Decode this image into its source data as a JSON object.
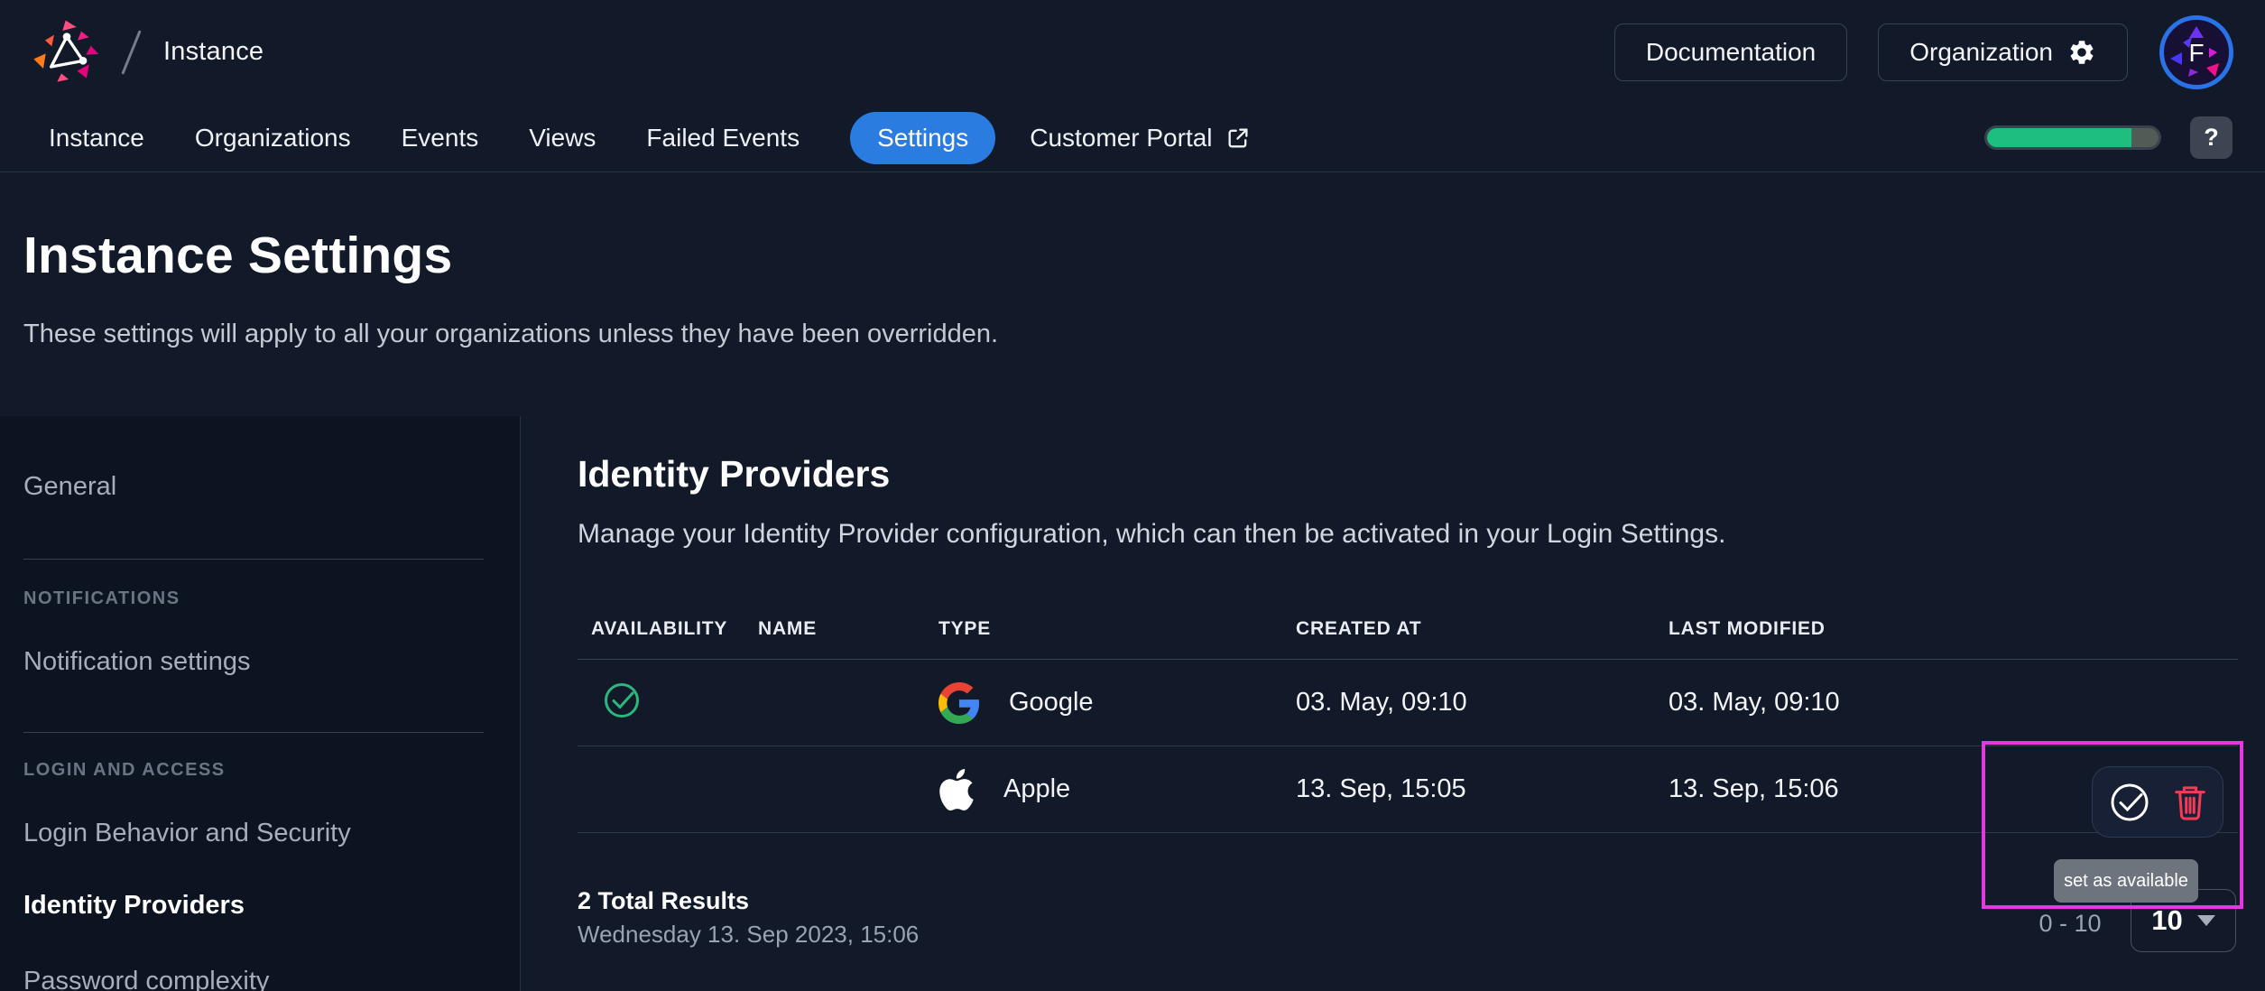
{
  "header": {
    "breadcrumb": "Instance",
    "documentation_button": "Documentation",
    "organization_button": "Organization",
    "avatar_letter": "F"
  },
  "nav": {
    "items": [
      "Instance",
      "Organizations",
      "Events",
      "Views",
      "Failed Events",
      "Settings",
      "Customer Portal"
    ],
    "active_item": "Settings",
    "progress_percent": 84,
    "help_button": "?"
  },
  "hero": {
    "title": "Instance Settings",
    "subtitle": "These settings will apply to all your organizations unless they have been overridden."
  },
  "sidebar": {
    "general_item": "General",
    "section_notifications": "NOTIFICATIONS",
    "notification_settings_item": "Notification settings",
    "section_login_access": "LOGIN AND ACCESS",
    "login_behavior_item": "Login Behavior and Security",
    "identity_providers_item": "Identity Providers",
    "password_complexity_item": "Password complexity",
    "active_item": "Identity Providers"
  },
  "content": {
    "title": "Identity Providers",
    "description": "Manage your Identity Provider configuration, which can then be activated in your Login Settings.",
    "table": {
      "columns": [
        "AVAILABILITY",
        "NAME",
        "TYPE",
        "CREATED AT",
        "LAST MODIFIED"
      ],
      "rows": [
        {
          "available": true,
          "name": "",
          "type": "Google",
          "created_at": "03. May, 09:10",
          "last_modified": "03. May, 09:10"
        },
        {
          "available": false,
          "name": "",
          "type": "Apple",
          "created_at": "13. Sep, 15:05",
          "last_modified": "13. Sep, 15:06"
        }
      ]
    },
    "total_results": "2 Total Results",
    "timestamp": "Wednesday 13. Sep 2023, 15:06",
    "pagination": {
      "range": "0 - 10",
      "page_size": "10"
    }
  },
  "overlay": {
    "tooltip": "set as available"
  },
  "colors": {
    "accent_blue": "#2b7ce0",
    "success_green": "#2bb77e",
    "danger_red": "#f43b55",
    "annotation_magenta": "#e438e4",
    "progress_green": "#1ebe7e"
  }
}
